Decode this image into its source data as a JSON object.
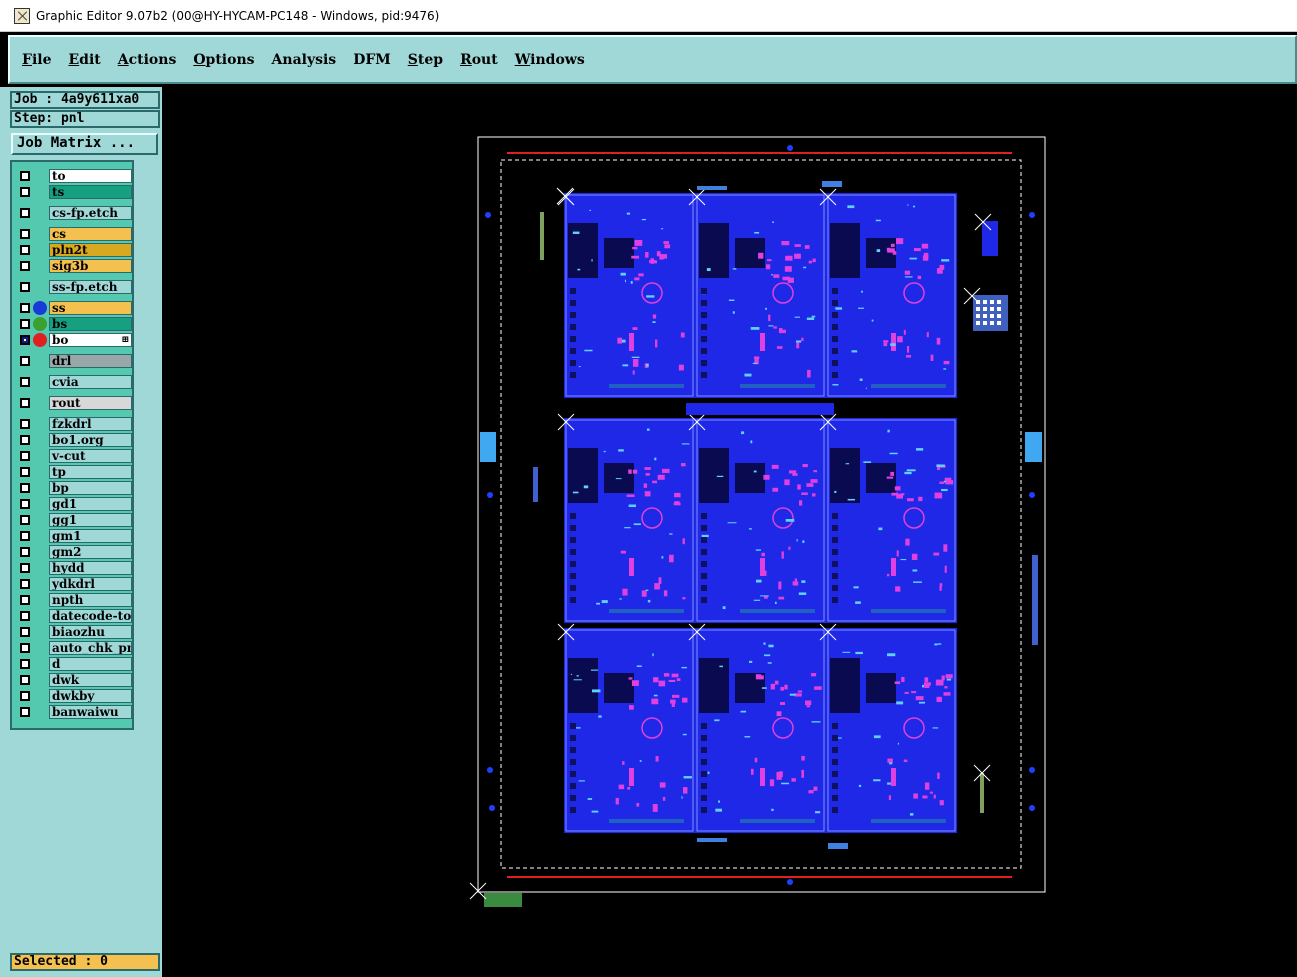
{
  "window": {
    "title": "Graphic Editor 9.07b2 (00@HY-HYCAM-PC148 - Windows, pid:9476)"
  },
  "menu": [
    {
      "label": "File",
      "underline": "F",
      "rest": "ile"
    },
    {
      "label": "Edit",
      "underline": "E",
      "rest": "dit"
    },
    {
      "label": "Actions",
      "underline": "A",
      "rest": "ctions"
    },
    {
      "label": "Options",
      "underline": "O",
      "rest": "ptions"
    },
    {
      "label": "Analysis",
      "underline": "",
      "rest": "Analysis"
    },
    {
      "label": "DFM",
      "underline": "",
      "rest": "DFM"
    },
    {
      "label": "Step",
      "underline": "S",
      "rest": "tep"
    },
    {
      "label": "Rout",
      "underline": "R",
      "rest": "out"
    },
    {
      "label": "Windows",
      "underline": "W",
      "rest": "indows"
    }
  ],
  "info": {
    "job": "Job : 4a9y611xa0",
    "step": "Step: pnl",
    "job_matrix": "Job Matrix ..."
  },
  "layers": [
    {
      "name": "to",
      "color": "#ffffff",
      "dot": "",
      "checked": false
    },
    {
      "name": "ts",
      "color": "#16a080",
      "dot": "",
      "checked": false
    },
    {
      "name": "cs-fp.etch",
      "color": "#a0d8d8",
      "dot": "",
      "checked": false
    },
    {
      "name": "cs",
      "color": "#f4c050",
      "dot": "",
      "checked": false
    },
    {
      "name": "pln2t",
      "color": "#d8a820",
      "dot": "",
      "checked": false
    },
    {
      "name": "sig3b",
      "color": "#f4c050",
      "dot": "",
      "checked": false
    },
    {
      "name": "ss-fp.etch",
      "color": "#a0d8d8",
      "dot": "",
      "checked": false
    },
    {
      "name": "ss",
      "color": "#f4c050",
      "dot": "#1a3ad8",
      "checked": false
    },
    {
      "name": "bs",
      "color": "#16a080",
      "dot": "#3aa030",
      "checked": false
    },
    {
      "name": "bo",
      "color": "#ffffff",
      "dot": "#e02020",
      "checked": true,
      "mark": "⊞"
    },
    {
      "name": "drl",
      "color": "#98a8a8",
      "dot": "",
      "checked": false
    },
    {
      "name": "cvia",
      "color": "#a0d8d8",
      "dot": "",
      "checked": false
    },
    {
      "name": "rout",
      "color": "#d8d8d8",
      "dot": "",
      "checked": false
    },
    {
      "name": "fzkdrl",
      "color": "#a0d8d8",
      "dot": "",
      "checked": false
    },
    {
      "name": "bo1.org",
      "color": "#a0d8d8",
      "dot": "",
      "checked": false
    },
    {
      "name": "v-cut",
      "color": "#a0d8d8",
      "dot": "",
      "checked": false
    },
    {
      "name": "tp",
      "color": "#a0d8d8",
      "dot": "",
      "checked": false
    },
    {
      "name": "bp",
      "color": "#a0d8d8",
      "dot": "",
      "checked": false
    },
    {
      "name": "gd1",
      "color": "#a0d8d8",
      "dot": "",
      "checked": false
    },
    {
      "name": "gg1",
      "color": "#a0d8d8",
      "dot": "",
      "checked": false
    },
    {
      "name": "gm1",
      "color": "#a0d8d8",
      "dot": "",
      "checked": false
    },
    {
      "name": "gm2",
      "color": "#a0d8d8",
      "dot": "",
      "checked": false
    },
    {
      "name": "hydd",
      "color": "#a0d8d8",
      "dot": "",
      "checked": false
    },
    {
      "name": "ydkdrl",
      "color": "#a0d8d8",
      "dot": "",
      "checked": false
    },
    {
      "name": "npth",
      "color": "#a0d8d8",
      "dot": "",
      "checked": false
    },
    {
      "name": "datecode-to",
      "color": "#a0d8d8",
      "dot": "",
      "checked": false
    },
    {
      "name": "biaozhu",
      "color": "#a0d8d8",
      "dot": "",
      "checked": false
    },
    {
      "name": "auto_chk_pnl",
      "color": "#a0d8d8",
      "dot": "",
      "checked": false
    },
    {
      "name": "d",
      "color": "#a0d8d8",
      "dot": "",
      "checked": false
    },
    {
      "name": "dwk",
      "color": "#a0d8d8",
      "dot": "",
      "checked": false
    },
    {
      "name": "dwkby",
      "color": "#a0d8d8",
      "dot": "",
      "checked": false
    },
    {
      "name": "banwaiwu",
      "color": "#a0d8d8",
      "dot": "",
      "checked": false
    }
  ],
  "status": {
    "selected": "Selected : 0"
  },
  "colors": {
    "board": "#1e28e6",
    "board_dark": "#0a0a50",
    "pad": "#e040e0",
    "trace": "#60d0ff",
    "frame": "#ffffff",
    "redline": "#e02020",
    "marker": "#40a8f0"
  }
}
